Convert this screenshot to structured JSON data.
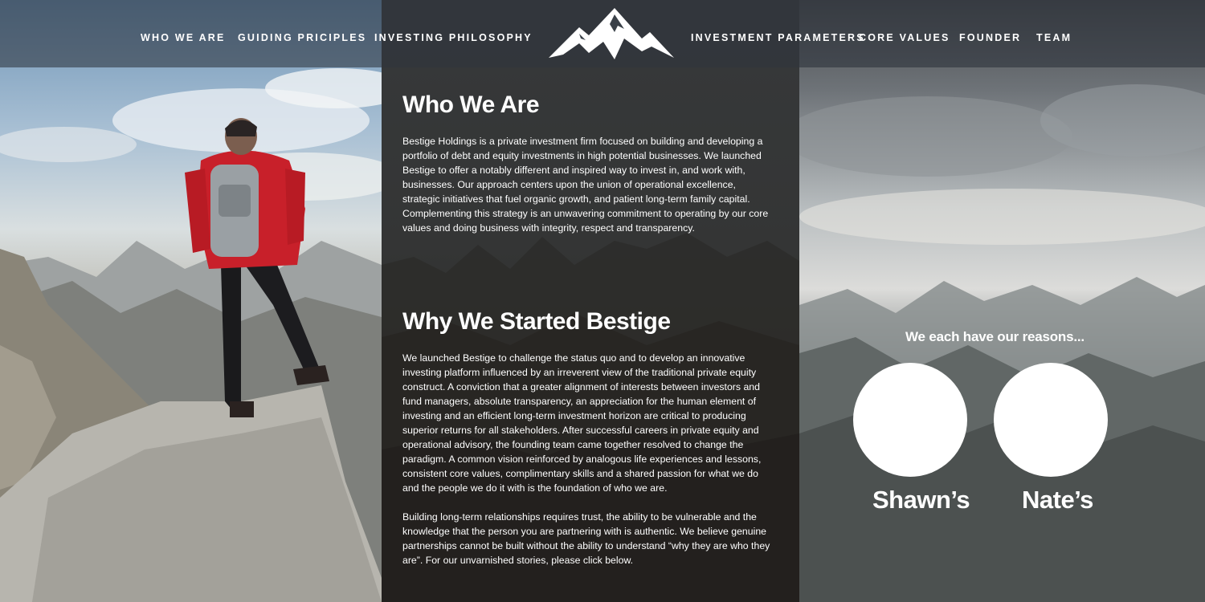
{
  "nav": {
    "left": [
      "WHO WE ARE",
      "GUIDING PRICIPLES",
      "INVESTING PHILOSOPHY"
    ],
    "right": [
      "INVESTMENT PARAMETERS",
      "CORE VALUES",
      "FOUNDER",
      "TEAM"
    ],
    "logo_icon": "mountain-logo-icon"
  },
  "who_we_are": {
    "heading": "Who We Are",
    "body": "Bestige Holdings is a private investment firm focused on building and developing a portfolio of debt and equity investments in high potential businesses.  We launched Bestige to offer a notably different and inspired way to invest in, and work with, businesses.  Our approach centers upon the union of operational excellence, strategic initiatives that fuel organic growth, and patient long-term family capital.  Complementing this strategy is an unwavering commitment to operating by our core values and doing business with integrity, respect and transparency."
  },
  "why_bestige": {
    "heading": "Why We Started Bestige",
    "body1": "We launched Bestige to challenge the status quo and to develop an innovative investing platform influenced by an irreverent view of the traditional private equity construct.  A conviction that a greater alignment of interests between investors and fund managers, absolute transparency, an appreciation for the human element of investing and an efficient long-term investment horizon are critical to producing superior returns for all stakeholders.  After successful careers in private equity and operational advisory, the founding team came together resolved to change the paradigm.  A common vision reinforced by analogous life experiences and lessons, consistent core values, complimentary skills and a shared passion for what we do and the people we do it with is the foundation of who we are.",
    "body2": "Building long-term relationships requires trust, the ability to be vulnerable and the knowledge that the person you are partnering with is authentic.  We believe genuine partnerships cannot be built without the ability to understand “why they are who they are”.   For our unvarnished stories, please click below."
  },
  "reasons": {
    "tagline": "We each have our reasons...",
    "people": [
      "Shawn’s",
      "Nate’s"
    ]
  },
  "colors": {
    "nav_bg": "#282e36",
    "jacket_red": "#c8202a",
    "text": "#ffffff"
  }
}
